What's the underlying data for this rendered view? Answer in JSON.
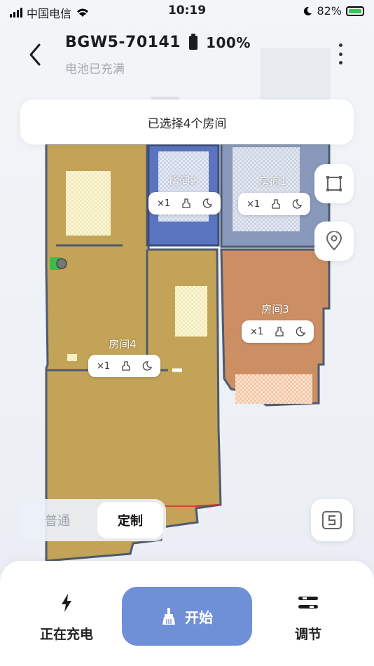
{
  "status_bar": {
    "carrier": "中国电信",
    "time": "10:19",
    "battery": "82%"
  },
  "header": {
    "device_name": "BGW5-70141",
    "battery_percent": "100%",
    "subtitle": "电池已充满"
  },
  "banner": {
    "text": "已选择4个房间"
  },
  "rooms": [
    {
      "name": "房间2",
      "passes": "×1"
    },
    {
      "name": "房间1",
      "passes": "×1"
    },
    {
      "name": "房间3",
      "passes": "×1"
    },
    {
      "name": "房间4",
      "passes": "×1"
    }
  ],
  "colors": {
    "room1": "#8899bb",
    "room2": "#5b74c0",
    "room3": "#cc8f63",
    "room4": "#c3a358",
    "accent": "#6f8fd6"
  },
  "mode_toggle": {
    "normal": "普通",
    "custom": "定制",
    "selected": "定制"
  },
  "bottom_bar": {
    "charging_label": "正在充电",
    "start_label": "开始",
    "adjust_label": "调节"
  },
  "icons": [
    "back-icon",
    "menu-dots-icon",
    "room-edit-icon",
    "location-pin-icon",
    "s-mode-icon",
    "broom-icon",
    "moon-icon",
    "lightning-icon",
    "adjust-icon"
  ]
}
